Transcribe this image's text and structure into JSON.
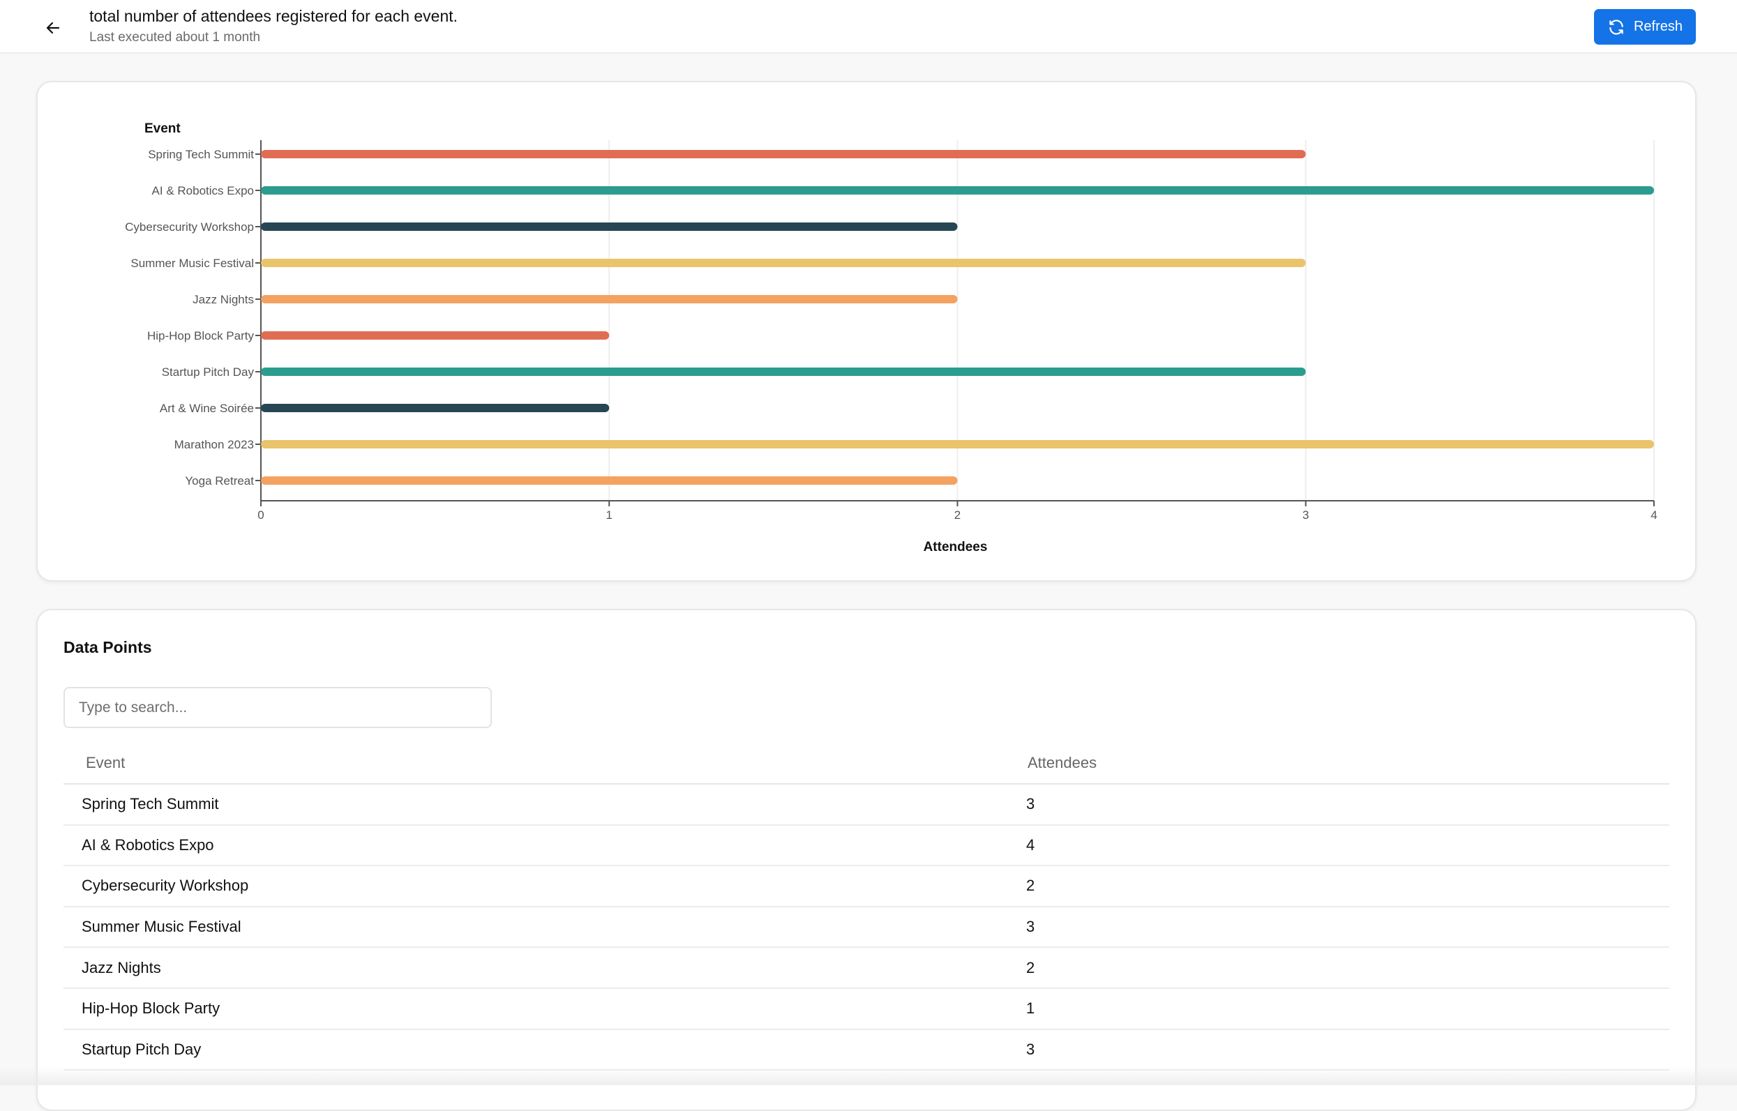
{
  "header": {
    "title": "total number of attendees registered for each event.",
    "subtitle": "Last executed about 1 month",
    "refresh_label": "Refresh"
  },
  "data_points": {
    "title": "Data Points",
    "search_placeholder": "Type to search...",
    "columns": [
      "Event",
      "Attendees"
    ],
    "rows": [
      [
        "Spring Tech Summit",
        "3"
      ],
      [
        "AI & Robotics Expo",
        "4"
      ],
      [
        "Cybersecurity Workshop",
        "2"
      ],
      [
        "Summer Music Festival",
        "3"
      ],
      [
        "Jazz Nights",
        "2"
      ],
      [
        "Hip-Hop Block Party",
        "1"
      ],
      [
        "Startup Pitch Day",
        "3"
      ]
    ]
  },
  "chart_data": {
    "type": "bar",
    "orientation": "horizontal",
    "categories": [
      "Spring Tech Summit",
      "AI & Robotics Expo",
      "Cybersecurity Workshop",
      "Summer Music Festival",
      "Jazz Nights",
      "Hip-Hop Block Party",
      "Startup Pitch Day",
      "Art & Wine Soirée",
      "Marathon 2023",
      "Yoga Retreat"
    ],
    "values": [
      3,
      4,
      2,
      3,
      2,
      1,
      3,
      1,
      4,
      2
    ],
    "colors": [
      "#e06d53",
      "#2a9d8f",
      "#264653",
      "#e9c46a",
      "#f4a261"
    ],
    "xlabel": "Attendees",
    "ylabel": "Event",
    "xlim": [
      0,
      4
    ],
    "xticks": [
      "0",
      "1",
      "2",
      "3",
      "4"
    ],
    "grid": true
  }
}
